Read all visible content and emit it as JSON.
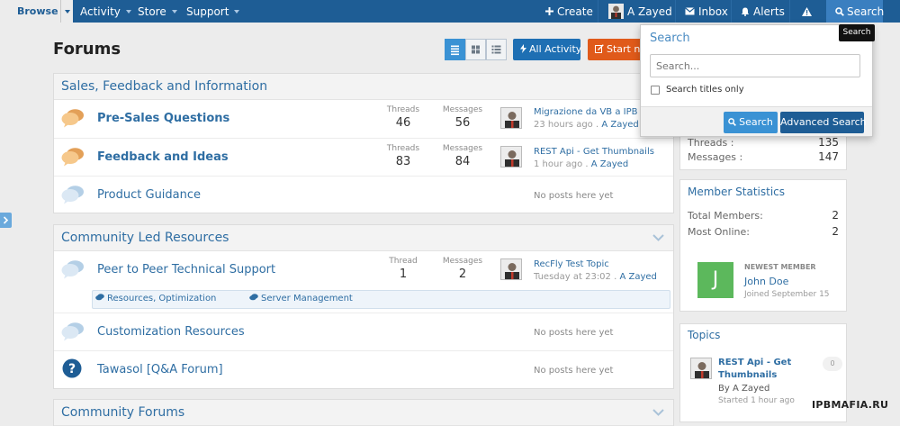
{
  "topnav": {
    "browse": "Browse",
    "items": [
      "Activity",
      "Store",
      "Support"
    ],
    "create": "Create",
    "user": "A Zayed",
    "inbox": "Inbox",
    "alerts": "Alerts",
    "search": "Search"
  },
  "header": {
    "title": "Forums",
    "all_activity": "All Activity",
    "start_new": "Start new"
  },
  "sections": [
    {
      "title": "Sales, Feedback and Information",
      "forums": [
        {
          "name": "Pre-Sales Questions",
          "icon": "chat-bubbles-orange-icon",
          "threads_label": "Threads",
          "threads": "46",
          "messages_label": "Messages",
          "messages": "56",
          "last_title": "Migrazione da VB a IPB",
          "last_time": "23 hours ago",
          "last_author": "A Zayed"
        },
        {
          "name": "Feedback and Ideas",
          "icon": "chat-bubbles-orange-icon",
          "threads_label": "Threads",
          "threads": "83",
          "messages_label": "Messages",
          "messages": "84",
          "last_title": "REST Api - Get Thumbnails",
          "last_time": "1 hour ago",
          "last_author": "A Zayed"
        },
        {
          "name": "Product Guidance",
          "icon": "chat-bubbles-blue-icon",
          "no_posts": "No posts here yet"
        }
      ]
    },
    {
      "title": "Community Led Resources",
      "forums": [
        {
          "name": "Peer to Peer Technical Support",
          "icon": "chat-bubbles-blue-icon",
          "threads_label": "Thread",
          "threads": "1",
          "messages_label": "Messages",
          "messages": "2",
          "last_title": "RecFly Test Topic",
          "last_time": "Tuesday at 23:02",
          "last_author": "A Zayed",
          "subforums": [
            "Resources, Optimization",
            "Server Management"
          ]
        },
        {
          "name": "Customization Resources",
          "icon": "chat-bubbles-blue-icon",
          "no_posts": "No posts here yet"
        },
        {
          "name": "Tawasol [Q&A Forum]",
          "icon": "question-icon",
          "no_posts": "No posts here yet"
        }
      ]
    },
    {
      "title": "Community Forums"
    }
  ],
  "sidebar": {
    "forum_stats": {
      "threads_label": "Threads :",
      "threads": "135",
      "messages_label": "Messages :",
      "messages": "147"
    },
    "member_stats": {
      "title": "Member Statistics",
      "total_label": "Total Members:",
      "total": "2",
      "online_label": "Most Online:",
      "online": "2",
      "newest_label": "NEWEST MEMBER",
      "newest_initial": "J",
      "newest_name": "John Doe",
      "newest_joined": "Joined September 15"
    },
    "topics": {
      "title": "Topics",
      "item_title_line1": "REST Api - Get",
      "item_title_line2": "Thumbnails",
      "item_by": "By A Zayed",
      "item_started": "Started 1 hour ago",
      "item_count": "0"
    }
  },
  "search_panel": {
    "title": "Search",
    "placeholder": "Search...",
    "titles_only": "Search titles only",
    "search_button": "Search",
    "advanced_button": "Advanced Search",
    "tooltip": "Search"
  },
  "watermark": "IPBMAFIA.RU",
  "colors": {
    "nav": "#1e5d95",
    "link": "#2f6ea3",
    "accent": "#3a92d4",
    "start_button": "#e05a1a",
    "newest_avatar": "#5cb85c"
  }
}
